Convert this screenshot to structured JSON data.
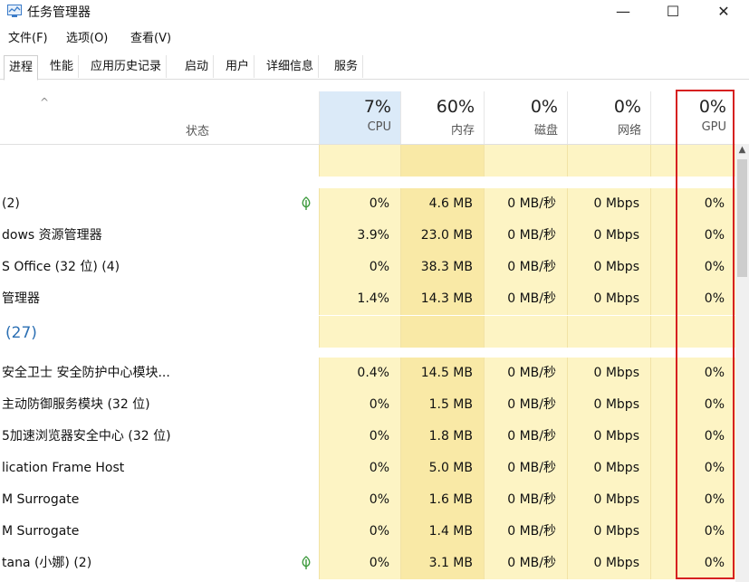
{
  "window": {
    "title": "任务管理器",
    "minimize_icon": "—",
    "maximize_icon": "☐",
    "close_icon": "✕"
  },
  "menu": [
    "文件(F)",
    "选项(O)",
    "查看(V)"
  ],
  "tabs": [
    "进程",
    "性能",
    "应用历史记录",
    "启动",
    "用户",
    "详细信息",
    "服务"
  ],
  "active_tab": 0,
  "header": {
    "status": "状态",
    "cpu": {
      "pct": "7%",
      "label": "CPU"
    },
    "mem": {
      "pct": "60%",
      "label": "内存"
    },
    "disk": {
      "pct": "0%",
      "label": "磁盘"
    },
    "net": {
      "pct": "0%",
      "label": "网络"
    },
    "gpu": {
      "pct": "0%",
      "label": "GPU"
    }
  },
  "rows": [
    {
      "name": "(2)",
      "cpu": "0%",
      "mem": "4.6 MB",
      "disk": "0 MB/秒",
      "net": "0 Mbps",
      "gpu": "0%",
      "leaf": true
    },
    {
      "name": "dows 资源管理器",
      "cpu": "3.9%",
      "mem": "23.0 MB",
      "disk": "0 MB/秒",
      "net": "0 Mbps",
      "gpu": "0%"
    },
    {
      "name": "S Office (32 位) (4)",
      "cpu": "0%",
      "mem": "38.3 MB",
      "disk": "0 MB/秒",
      "net": "0 Mbps",
      "gpu": "0%"
    },
    {
      "name": "管理器",
      "cpu": "1.4%",
      "mem": "14.3 MB",
      "disk": "0 MB/秒",
      "net": "0 Mbps",
      "gpu": "0%"
    }
  ],
  "group_label": "(27)",
  "rows2": [
    {
      "name": "安全卫士 安全防护中心模块...",
      "cpu": "0.4%",
      "mem": "14.5 MB",
      "disk": "0 MB/秒",
      "net": "0 Mbps",
      "gpu": "0%"
    },
    {
      "name": "主动防御服务模块 (32 位)",
      "cpu": "0%",
      "mem": "1.5 MB",
      "disk": "0 MB/秒",
      "net": "0 Mbps",
      "gpu": "0%"
    },
    {
      "name": "5加速浏览器安全中心 (32 位)",
      "cpu": "0%",
      "mem": "1.8 MB",
      "disk": "0 MB/秒",
      "net": "0 Mbps",
      "gpu": "0%"
    },
    {
      "name": "lication Frame Host",
      "cpu": "0%",
      "mem": "5.0 MB",
      "disk": "0 MB/秒",
      "net": "0 Mbps",
      "gpu": "0%"
    },
    {
      "name": "M Surrogate",
      "cpu": "0%",
      "mem": "1.6 MB",
      "disk": "0 MB/秒",
      "net": "0 Mbps",
      "gpu": "0%"
    },
    {
      "name": "M Surrogate",
      "cpu": "0%",
      "mem": "1.4 MB",
      "disk": "0 MB/秒",
      "net": "0 Mbps",
      "gpu": "0%"
    },
    {
      "name": "tana (小娜) (2)",
      "cpu": "0%",
      "mem": "3.1 MB",
      "disk": "0 MB/秒",
      "net": "0 Mbps",
      "gpu": "0%",
      "leaf": true
    }
  ],
  "colors": {
    "cpu_bg": "#fdf4c4",
    "mem_bg": "#f9e9a6",
    "other_bg": "#fdf4c4",
    "highlight": "#d62020",
    "group_text": "#2b6fb3"
  }
}
